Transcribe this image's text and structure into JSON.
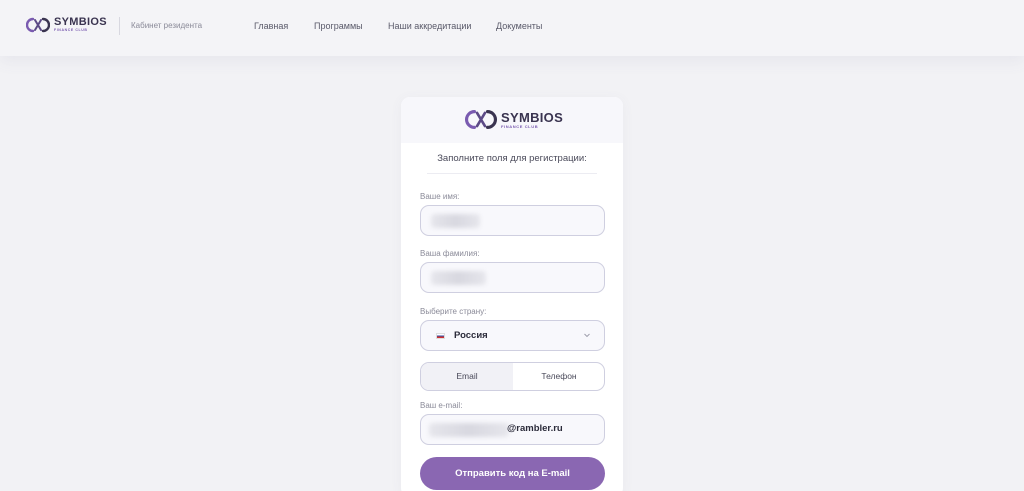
{
  "header": {
    "logo": {
      "name": "SYMBIOS",
      "sub": "FINANCE CLUB"
    },
    "cabinet_label": "Кабинет резидента",
    "nav": [
      "Главная",
      "Программы",
      "Наши аккредитации",
      "Документы"
    ]
  },
  "card": {
    "logo": {
      "name": "SYMBIOS",
      "sub": "FINANCE CLUB"
    },
    "title": "Заполните поля для регистрации:",
    "first_name": {
      "label": "Ваше имя:",
      "value": ""
    },
    "last_name": {
      "label": "Ваша фамилия:",
      "value": ""
    },
    "country": {
      "label": "Выберите страну:",
      "value": "Россия"
    },
    "contact_tabs": {
      "options": [
        "Email",
        "Телефон"
      ],
      "selected": "Email"
    },
    "email": {
      "label": "Ваш e-mail:",
      "value_suffix": "@rambler.ru"
    },
    "submit_label": "Отправить код на E-mail"
  },
  "colors": {
    "accent": "#8a67b2",
    "background": "#f2f2f5"
  }
}
